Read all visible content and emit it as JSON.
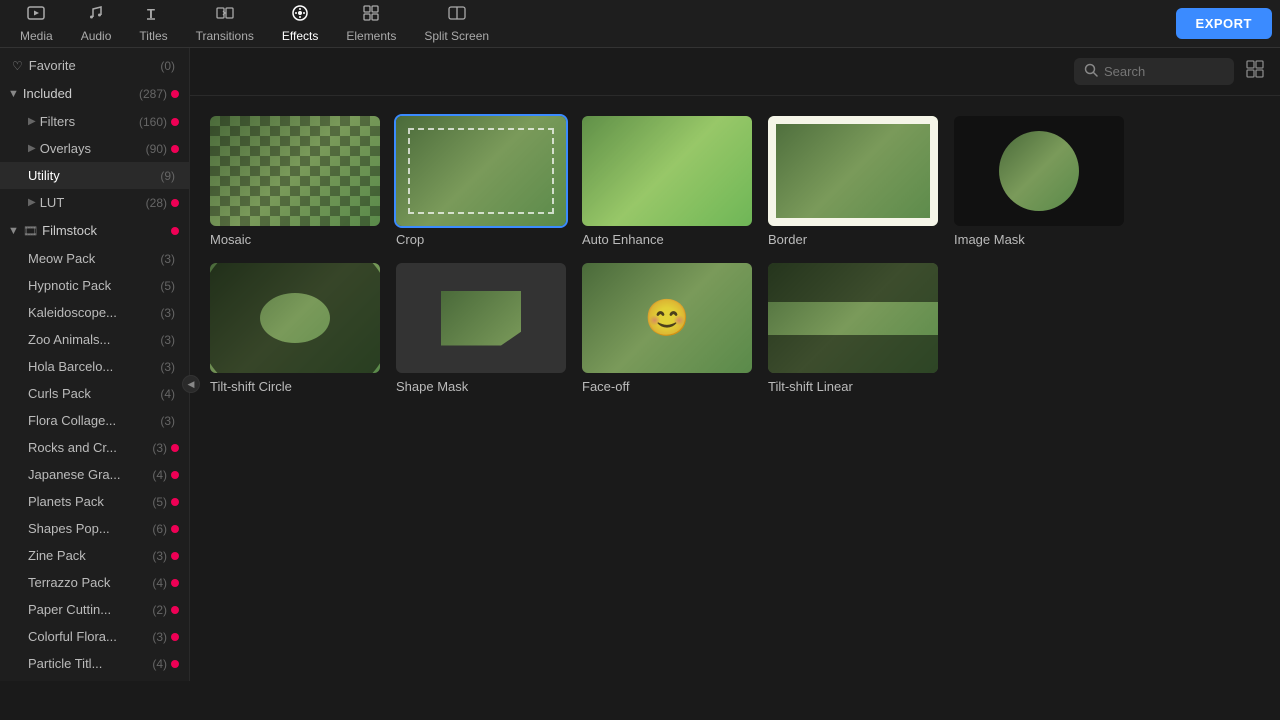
{
  "nav": {
    "items": [
      {
        "id": "media",
        "label": "Media",
        "icon": "🎬"
      },
      {
        "id": "audio",
        "label": "Audio",
        "icon": "🎵"
      },
      {
        "id": "titles",
        "label": "Titles",
        "icon": "T"
      },
      {
        "id": "transitions",
        "label": "Transitions",
        "icon": "↔"
      },
      {
        "id": "effects",
        "label": "Effects",
        "icon": "✨"
      },
      {
        "id": "elements",
        "label": "Elements",
        "icon": "⬛"
      },
      {
        "id": "split-screen",
        "label": "Split Screen",
        "icon": "⊞"
      }
    ],
    "export_label": "EXPORT"
  },
  "sidebar": {
    "favorite": {
      "label": "Favorite",
      "count": "(0)"
    },
    "included": {
      "label": "Included",
      "count": "(287)"
    },
    "filters": {
      "label": "Filters",
      "count": "(160)"
    },
    "overlays": {
      "label": "Overlays",
      "count": "(90)"
    },
    "utility": {
      "label": "Utility",
      "count": "(9)"
    },
    "lut": {
      "label": "LUT",
      "count": "(28)"
    },
    "filmstock": {
      "label": "Filmstock",
      "count": ""
    },
    "packs": [
      {
        "label": "Meow Pack",
        "count": "(3)",
        "has_dot": false
      },
      {
        "label": "Hypnotic Pack",
        "count": "(5)",
        "has_dot": false
      },
      {
        "label": "Kaleidoscope...",
        "count": "(3)",
        "has_dot": false
      },
      {
        "label": "Zoo Animals...",
        "count": "(3)",
        "has_dot": false
      },
      {
        "label": "Hola Barcelo...",
        "count": "(3)",
        "has_dot": false
      },
      {
        "label": "Curls Pack",
        "count": "(4)",
        "has_dot": false
      },
      {
        "label": "Flora Collage...",
        "count": "(3)",
        "has_dot": false
      },
      {
        "label": "Rocks and Cr...",
        "count": "(3)",
        "has_dot": true
      },
      {
        "label": "Japanese Gra...",
        "count": "(4)",
        "has_dot": true
      },
      {
        "label": "Planets Pack",
        "count": "(5)",
        "has_dot": true
      },
      {
        "label": "Shapes Pop...",
        "count": "(6)",
        "has_dot": true
      },
      {
        "label": "Zine Pack",
        "count": "(3)",
        "has_dot": true
      },
      {
        "label": "Terrazzo Pack",
        "count": "(4)",
        "has_dot": true
      },
      {
        "label": "Paper Cuttin...",
        "count": "(2)",
        "has_dot": true
      },
      {
        "label": "Colorful Flora...",
        "count": "(3)",
        "has_dot": true
      },
      {
        "label": "Particle Titl...",
        "count": "(4)",
        "has_dot": true
      }
    ]
  },
  "toolbar": {
    "search_placeholder": "Search"
  },
  "effects": [
    {
      "id": "mosaic",
      "label": "Mosaic",
      "type": "mosaic"
    },
    {
      "id": "crop",
      "label": "Crop",
      "type": "crop",
      "selected": true
    },
    {
      "id": "auto-enhance",
      "label": "Auto Enhance",
      "type": "auto-enhance"
    },
    {
      "id": "border",
      "label": "Border",
      "type": "border"
    },
    {
      "id": "image-mask",
      "label": "Image Mask",
      "type": "image-mask"
    },
    {
      "id": "tiltshift-circle",
      "label": "Tilt-shift Circle",
      "type": "tiltshift-circle"
    },
    {
      "id": "shape-mask",
      "label": "Shape Mask",
      "type": "shape-mask"
    },
    {
      "id": "face-off",
      "label": "Face-off",
      "type": "faceoff"
    },
    {
      "id": "tiltshift-linear",
      "label": "Tilt-shift Linear",
      "type": "tiltshift-linear"
    }
  ]
}
